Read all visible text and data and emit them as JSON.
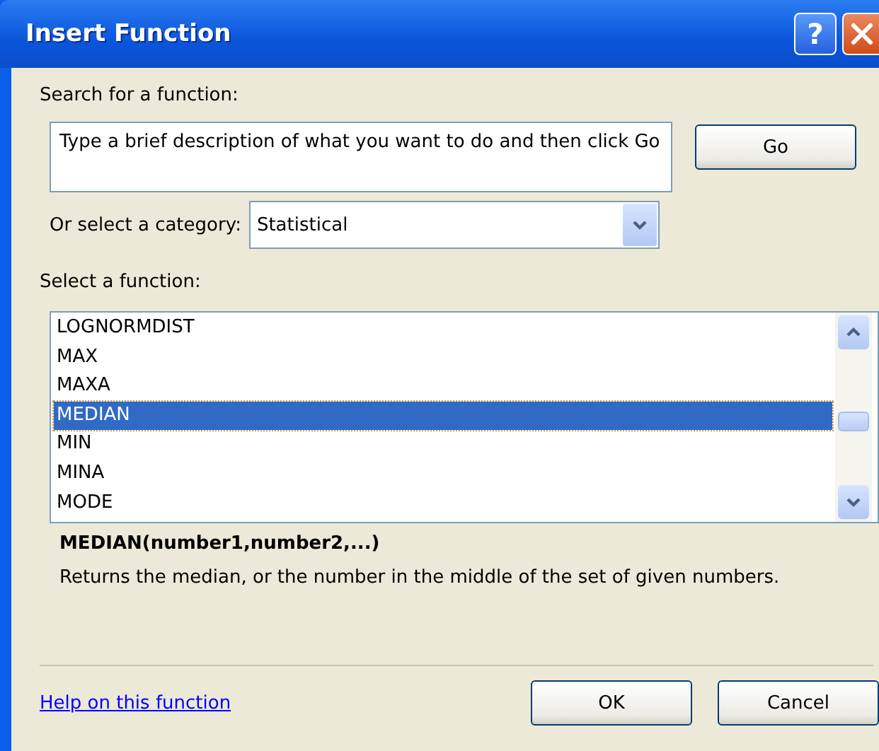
{
  "window": {
    "title": "Insert Function",
    "buttons": [
      {
        "kind": "help",
        "label": "?"
      },
      {
        "kind": "close"
      }
    ]
  },
  "search": {
    "label": "Search for a function:",
    "value": "Type a brief description of what you want to do and then click Go",
    "button": "Go"
  },
  "category": {
    "label": "Or select a category:",
    "value": "Statistical"
  },
  "functions": {
    "label": "Select a function:",
    "items": [
      {
        "name": "LOGNORMDIST",
        "selected": false
      },
      {
        "name": "MAX",
        "selected": false
      },
      {
        "name": "MAXA",
        "selected": false
      },
      {
        "name": "MEDIAN",
        "selected": true
      },
      {
        "name": "MIN",
        "selected": false
      },
      {
        "name": "MINA",
        "selected": false
      },
      {
        "name": "MODE",
        "selected": false
      }
    ]
  },
  "signature": "MEDIAN(number1,number2,...)",
  "description": "Returns the median, or the number in the middle of the set of given numbers.",
  "help_link": "Help on this function",
  "buttons": [
    "OK",
    "Cancel"
  ]
}
